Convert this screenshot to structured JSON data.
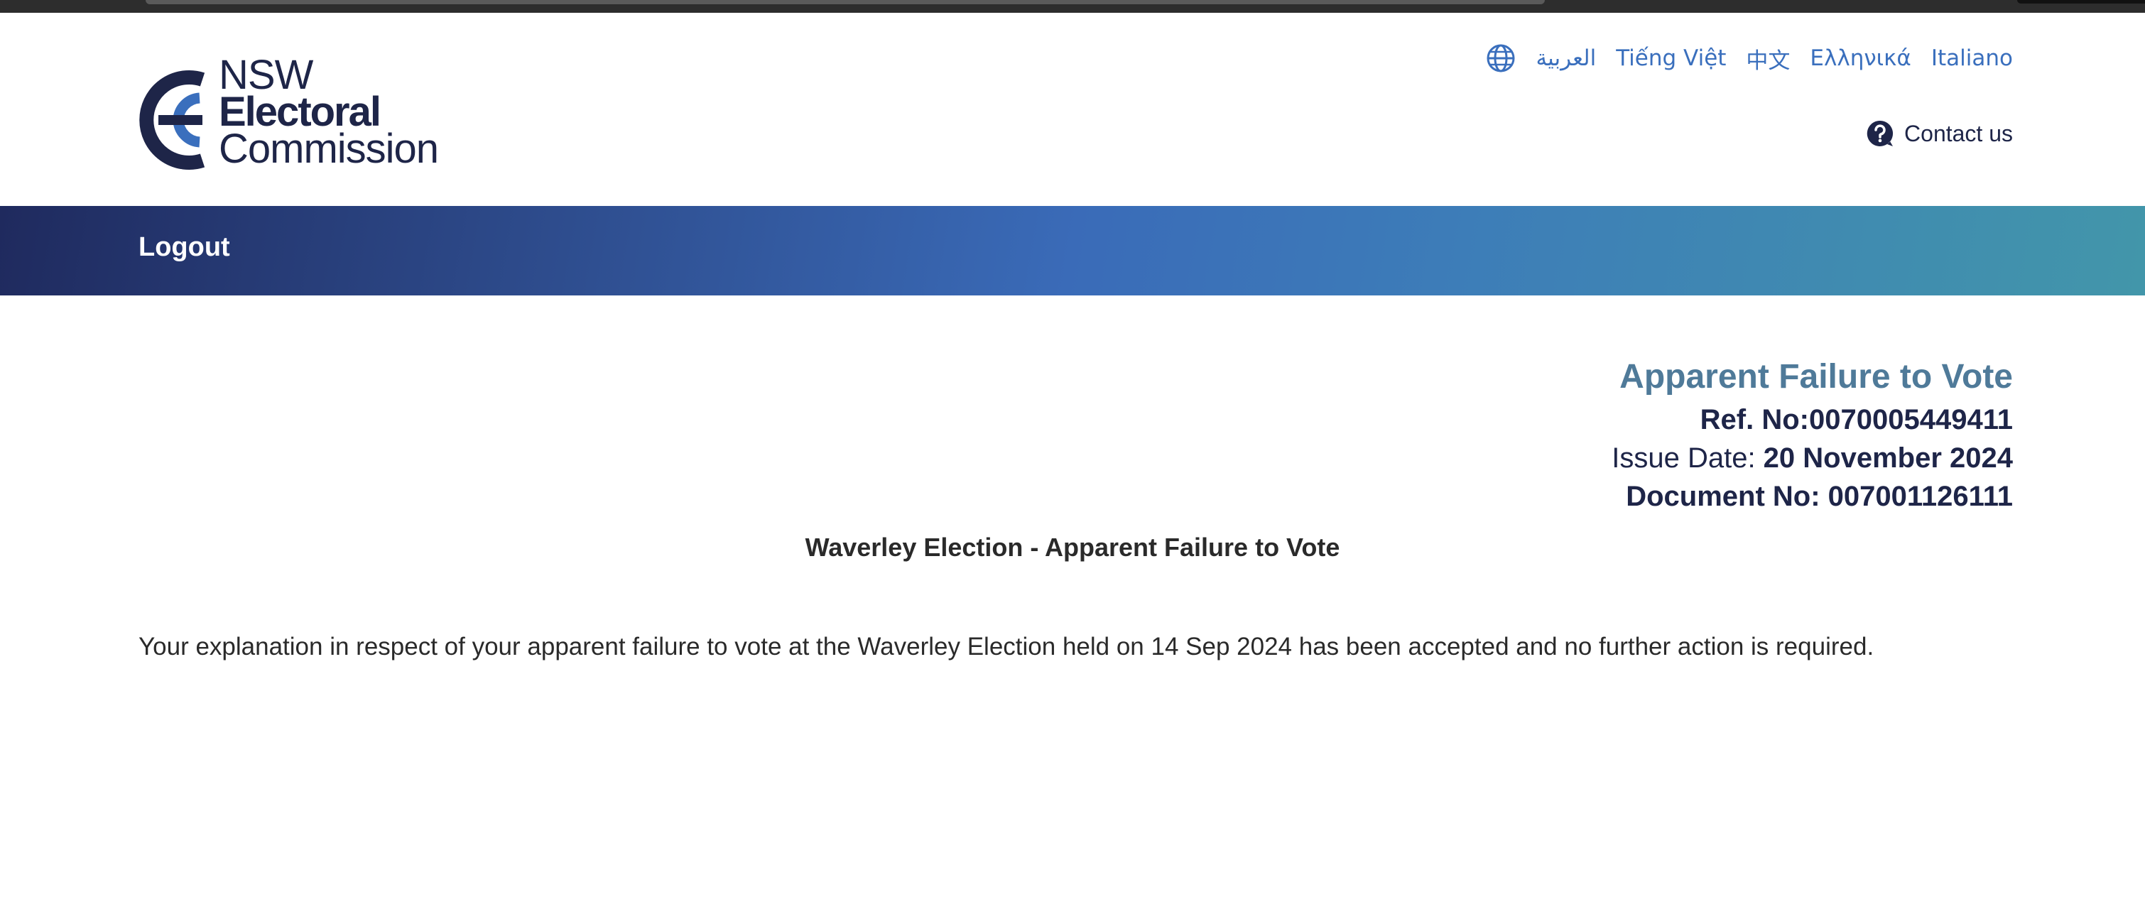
{
  "header": {
    "logo": {
      "line1": "NSW",
      "line2": "Electoral",
      "line3": "Commission"
    },
    "languages": [
      "العربية",
      "Tiếng Việt",
      "中文",
      "Ελληνικά",
      "Italiano"
    ],
    "contact_label": "Contact us",
    "icons": {
      "language": "globe-icon",
      "contact": "question-circle-icon"
    }
  },
  "nav": {
    "logout_label": "Logout"
  },
  "document": {
    "title": "Apparent Failure to Vote",
    "ref_label": "Ref. No:",
    "ref_value": "0070005449411",
    "issue_label": "Issue Date: ",
    "issue_value": "20 November 2024",
    "docno_label": "Document No: ",
    "docno_value": "007001126111",
    "subject": "Waverley Election - Apparent Failure to Vote",
    "body": "Your explanation in respect of your apparent failure to vote at the Waverley Election held on 14 Sep 2024 has been accepted and no further action is required."
  },
  "colors": {
    "brand_navy": "#1e2548",
    "brand_blue": "#3a6fbd",
    "title_teal": "#4f7a99"
  }
}
